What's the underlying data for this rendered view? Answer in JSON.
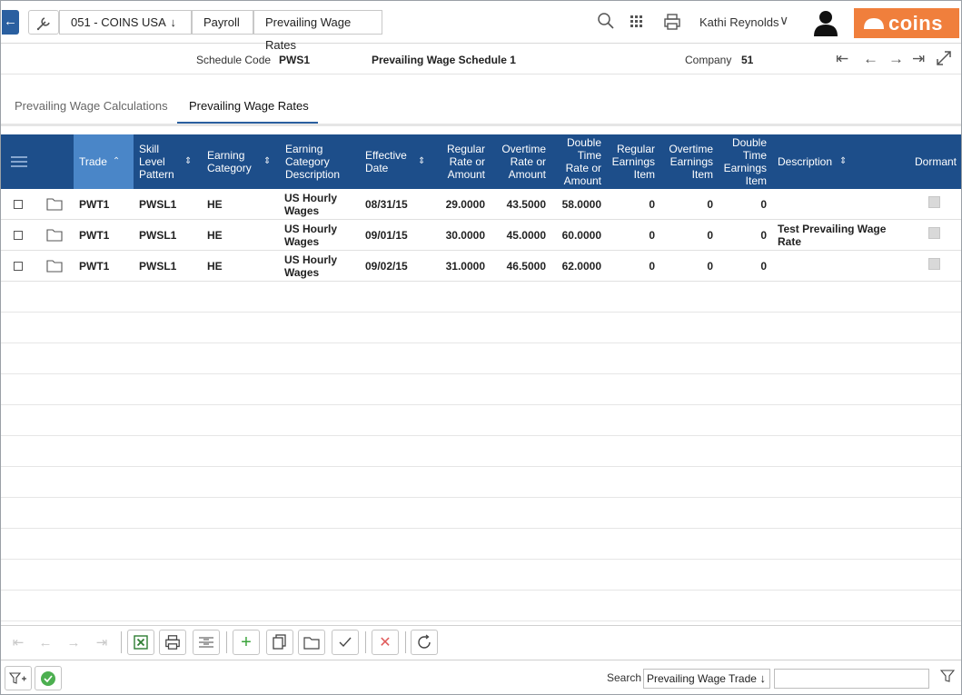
{
  "header": {
    "breadcrumbs": [
      "051 - COINS USA",
      "Payroll",
      "Prevailing Wage Rates"
    ],
    "user_name": "Kathi Reynolds",
    "logo_text": "coins",
    "accent": "#2a5fa0",
    "logo_color": "#f07f3c"
  },
  "schedule": {
    "code_label": "Schedule Code",
    "code_value": "PWS1",
    "name": "Prevailing Wage Schedule 1",
    "company_label": "Company",
    "company_value": "51"
  },
  "tabs": [
    {
      "label": "Prevailing Wage Calculations",
      "active": false
    },
    {
      "label": "Prevailing Wage Rates",
      "active": true
    }
  ],
  "table": {
    "header_color": "#1d4e8a",
    "columns": [
      "Trade",
      "Skill Level Pattern",
      "Earning Category",
      "Earning Category Description",
      "Effective Date",
      "Regular Rate or Amount",
      "Overtime Rate or Amount",
      "Double Time Rate or Amount",
      "Regular Earnings Item",
      "Overtime Earnings Item",
      "Double Time Earnings Item",
      "Description",
      "Dormant"
    ],
    "rows": [
      {
        "trade": "PWT1",
        "skill": "PWSL1",
        "cat": "HE",
        "catdesc": "US Hourly Wages",
        "date": "08/31/15",
        "reg": "29.0000",
        "ot": "43.5000",
        "dt": "58.0000",
        "regitem": "0",
        "otitem": "0",
        "dtitem": "0",
        "desc": ""
      },
      {
        "trade": "PWT1",
        "skill": "PWSL1",
        "cat": "HE",
        "catdesc": "US Hourly Wages",
        "date": "09/01/15",
        "reg": "30.0000",
        "ot": "45.0000",
        "dt": "60.0000",
        "regitem": "0",
        "otitem": "0",
        "dtitem": "0",
        "desc": "Test Prevailing Wage Rate"
      },
      {
        "trade": "PWT1",
        "skill": "PWSL1",
        "cat": "HE",
        "catdesc": "US Hourly Wages",
        "date": "09/02/15",
        "reg": "31.0000",
        "ot": "46.5000",
        "dt": "62.0000",
        "regitem": "0",
        "otitem": "0",
        "dtitem": "0",
        "desc": ""
      }
    ]
  },
  "footer": {
    "search_label": "Search",
    "search_field": "Prevailing Wage Trade",
    "search_value": ""
  }
}
